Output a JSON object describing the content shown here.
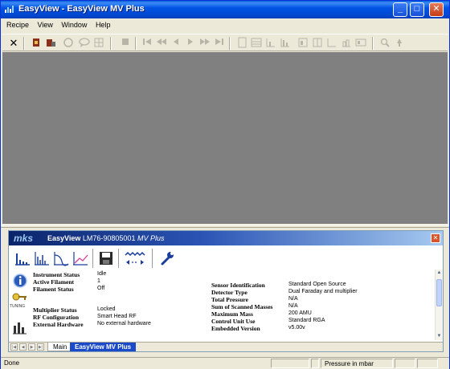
{
  "window": {
    "title": "EasyView - EasyView MV Plus",
    "buttons": {
      "minimize": "_",
      "maximize": "□",
      "close": "✕"
    }
  },
  "menu": [
    "Recipe",
    "View",
    "Window",
    "Help"
  ],
  "toolbar": {
    "icons": [
      "close-x-icon",
      "connect-icon",
      "disconnect-icon",
      "scan-icon",
      "chat-icon",
      "grid-icon",
      "stop-icon",
      "first-icon",
      "rewind-icon",
      "back-icon",
      "play-icon",
      "forward-icon",
      "last-icon",
      "doc-icon",
      "table-icon",
      "chart-icon",
      "bar-icon",
      "zoom-icon",
      "lamp-icon"
    ],
    "close_glyph": "✕"
  },
  "panel": {
    "brand": "mks",
    "title_prefix": "EasyView",
    "title_serial": "LM76-90805001",
    "title_model": "MV Plus",
    "close_glyph": "✕",
    "tools": [
      "bar-spectrum-icon",
      "peak-spectrum-icon",
      "trend-icon",
      "line-chart-icon",
      "save-icon",
      "scan-wave-icon",
      "wrench-icon"
    ],
    "side_labels": {
      "tuning": "TUNING"
    },
    "rows_left": [
      {
        "label": "Instrument Status",
        "value": "Idle"
      },
      {
        "label": "Active Filament",
        "value": "1"
      },
      {
        "label": "Filament Status",
        "value": "Off"
      },
      {
        "label": "Multiplier Status",
        "value": "Locked"
      },
      {
        "label": "RF Configuration",
        "value": "Smart Head RF"
      },
      {
        "label": "External Hardware",
        "value": "No external hardware"
      }
    ],
    "rows_right": [
      {
        "label": "Sensor Identification",
        "value": "Standard Open Source"
      },
      {
        "label": "Detector Type",
        "value": "Dual Faraday and multiplier"
      },
      {
        "label": "Total Pressure",
        "value": "N/A"
      },
      {
        "label": "Sum of Scanned Masses",
        "value": "N/A"
      },
      {
        "label": "Maximum Mass",
        "value": "200 AMU"
      },
      {
        "label": "Control Unit Use",
        "value": "Standard RGA"
      },
      {
        "label": "Embedded Version",
        "value": "v5.00v"
      }
    ],
    "tabs": [
      "Main",
      "EasyView MV Plus"
    ]
  },
  "status": {
    "left": "Done",
    "right": "Pressure in mbar"
  },
  "colors": {
    "title_blue": "#0054e3",
    "mdi_gray": "#808080",
    "panel_title": "#0a246a",
    "tab_active": "#1a4ac7"
  }
}
